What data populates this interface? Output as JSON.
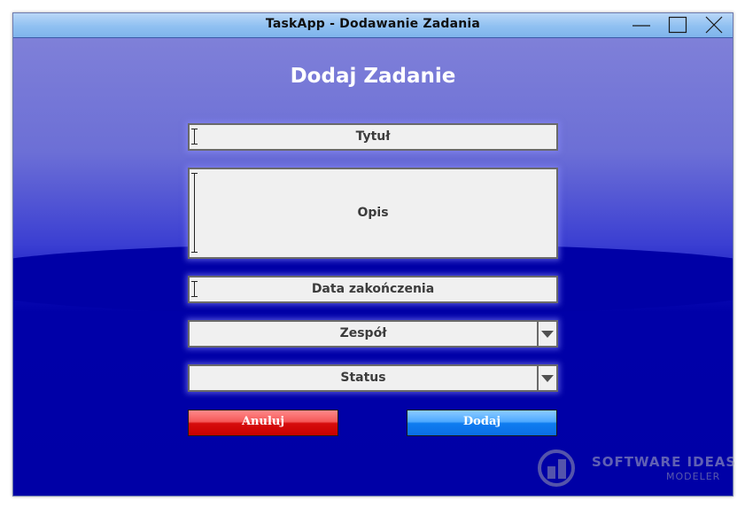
{
  "window": {
    "title": "TaskApp - Dodawanie Zadania"
  },
  "form": {
    "heading": "Dodaj Zadanie",
    "title_field": {
      "placeholder": "Tytuł"
    },
    "description_field": {
      "placeholder": "Opis"
    },
    "due_date_field": {
      "placeholder": "Data zakończenia"
    },
    "team_select": {
      "selected": "Zespół"
    },
    "status_select": {
      "selected": "Status"
    },
    "cancel_label": "Anuluj",
    "add_label": "Dodaj"
  },
  "watermark": {
    "line1": "SOFTWARE IDEAS",
    "line2": "MODELER"
  },
  "colors": {
    "background": "#0000a6",
    "titlebar": "#8fc0f1",
    "cancel_button": "#d60d0d",
    "add_button": "#0f7cf0"
  },
  "icons": [
    "minimize-icon",
    "maximize-icon",
    "close-icon",
    "dropdown-arrow-icon",
    "text-cursor-icon"
  ]
}
